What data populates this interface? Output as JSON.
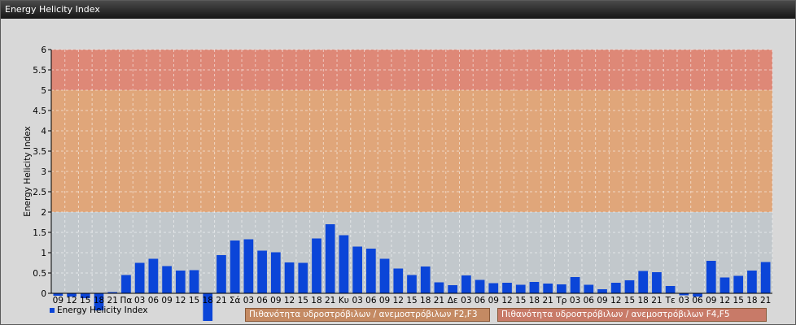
{
  "window": {
    "title": "Energy Helicity Index"
  },
  "colors": {
    "bar": "#0b45d8",
    "zone_high": "#de8877",
    "zone_mid": "#e0a67a",
    "zone_low": "#c2c8cc",
    "legend_mid": "#c48a63",
    "legend_high": "#c87a68"
  },
  "legend": {
    "series_label": "Energy Helicity Index",
    "zone_mid_label": "Πιθανότητα υδροστρόβιλων / ανεμοστρόβιλων F2,F3",
    "zone_high_label": "Πιθανότητα υδροστρόβιλων / ανεμοστρόβιλων F4,F5"
  },
  "chart_data": {
    "type": "bar",
    "ylabel": "Energy Helicity Index",
    "ylim": [
      0,
      6
    ],
    "yticks": [
      "0",
      "0.5",
      "1",
      "1.5",
      "2",
      "2.5",
      "3",
      "3.5",
      "4",
      "4.5",
      "5",
      "5.5",
      "6"
    ],
    "grid": true,
    "zones": [
      {
        "from": 0,
        "to": 2,
        "color_key": "zone_low"
      },
      {
        "from": 2,
        "to": 5,
        "color_key": "zone_mid"
      },
      {
        "from": 5,
        "to": 6,
        "color_key": "zone_high"
      }
    ],
    "categories": [
      "09",
      "12",
      "15",
      "18",
      "21",
      "Πα",
      "03",
      "06",
      "09",
      "12",
      "15",
      "18",
      "21",
      "Σά",
      "03",
      "06",
      "09",
      "12",
      "15",
      "18",
      "21",
      "Κυ",
      "03",
      "06",
      "09",
      "12",
      "15",
      "18",
      "21",
      "Δε",
      "03",
      "06",
      "09",
      "12",
      "15",
      "18",
      "21",
      "Τρ",
      "03",
      "06",
      "09",
      "12",
      "15",
      "18",
      "21",
      "Τε",
      "03",
      "06",
      "09",
      "12",
      "15",
      "18",
      "21"
    ],
    "values": [
      -0.06,
      -0.08,
      -0.12,
      -0.42,
      0.03,
      0.45,
      0.75,
      0.85,
      0.67,
      0.56,
      0.57,
      -0.68,
      0.94,
      1.3,
      1.33,
      1.05,
      1.01,
      0.76,
      0.75,
      1.35,
      1.7,
      1.43,
      1.15,
      1.1,
      0.85,
      0.61,
      0.45,
      0.66,
      0.27,
      0.2,
      0.44,
      0.33,
      0.25,
      0.26,
      0.21,
      0.28,
      0.24,
      0.22,
      0.4,
      0.21,
      0.1,
      0.26,
      0.32,
      0.55,
      0.52,
      0.18,
      -0.05,
      -0.08,
      0.8,
      0.39,
      0.43,
      0.56,
      0.77
    ]
  }
}
